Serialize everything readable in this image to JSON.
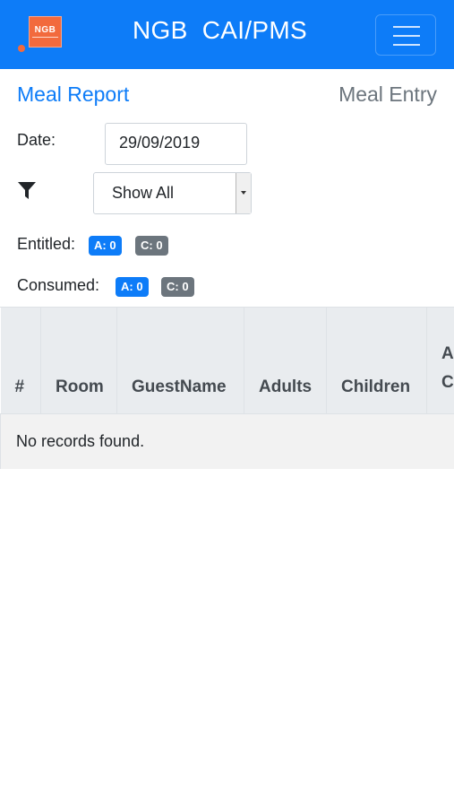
{
  "navbar": {
    "logo_text": "NGB",
    "brand": "NGB  CAI/PMS"
  },
  "header": {
    "meal_report": "Meal Report",
    "meal_entry": "Meal Entry"
  },
  "form": {
    "date_label": "Date:",
    "date_value": "29/09/2019",
    "filter_value": "Show All"
  },
  "summary": {
    "entitled_label": "Entitled:",
    "entitled_adults": "A: 0",
    "entitled_children": "C: 0",
    "consumed_label": "Consumed:",
    "consumed_adults": "A: 0",
    "consumed_children": "C: 0"
  },
  "table": {
    "columns": [
      "#",
      "Room",
      "GuestName",
      "Adults",
      "Children",
      "Ad",
      "Co"
    ],
    "empty_message": "No records found."
  },
  "colors": {
    "primary": "#0d7cf8",
    "secondary": "#6c757d",
    "logo": "#f26a3d"
  }
}
